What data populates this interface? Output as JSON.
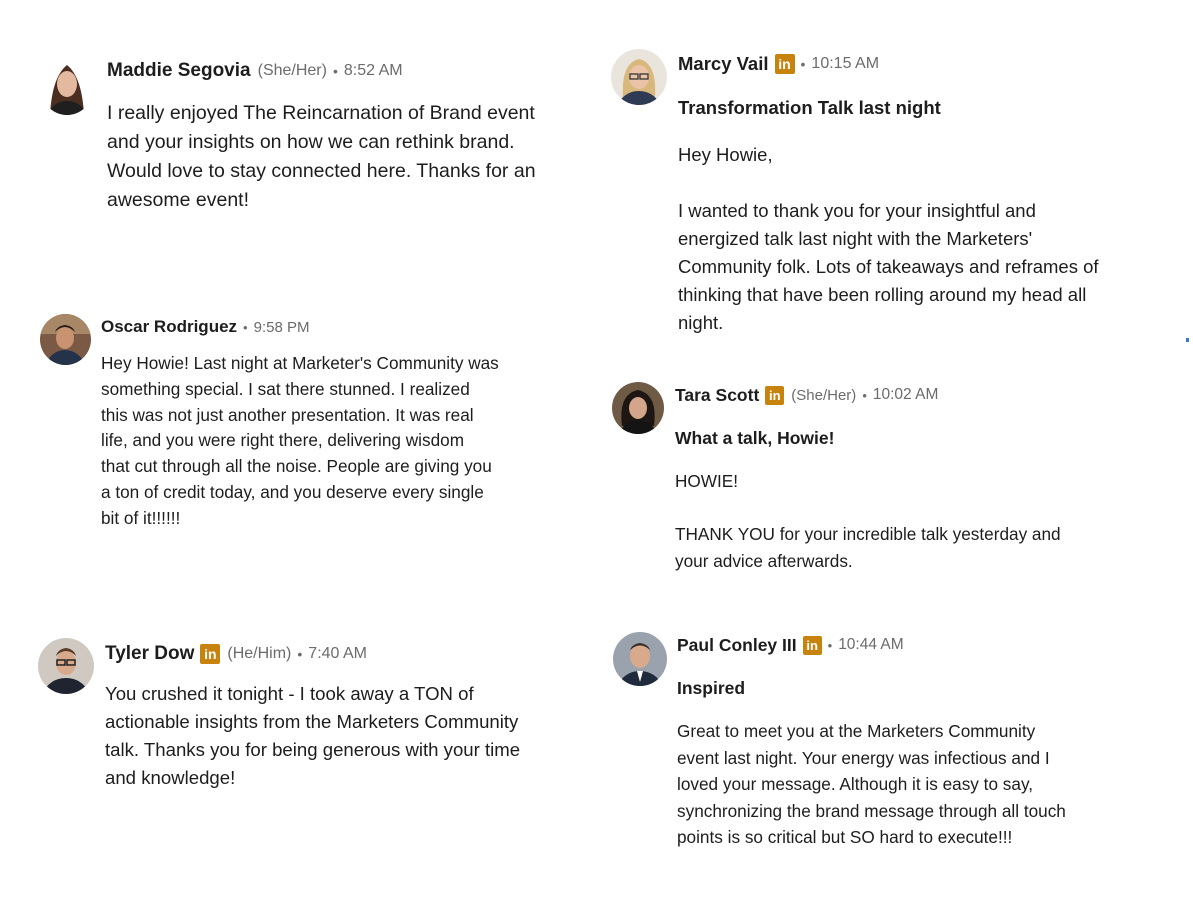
{
  "colors": {
    "linkedin_badge": "#c8830f",
    "meta_gray": "#6b6b6b",
    "text": "#1d1d1d"
  },
  "messages": [
    {
      "name": "Maddie Segovia",
      "pronouns": "(She/Her)",
      "time": "8:52 AM",
      "avatar": "person-avatar",
      "lines": [
        "I really enjoyed The Reincarnation of Brand event",
        "and your insights on how we can rethink brand.",
        "Would love to stay connected here. Thanks for an",
        "awesome event!"
      ]
    },
    {
      "name": "Oscar Rodriguez",
      "time": "9:58 PM",
      "avatar": "person-avatar",
      "lines": [
        "Hey Howie! Last night at Marketer's Community was",
        "something special. I sat there stunned. I realized",
        "this was not just another presentation. It was real",
        "life, and you were right there, delivering wisdom",
        "that cut through all the noise. People are giving you",
        "a ton of credit today, and you deserve every single",
        "bit of it!!!!!!"
      ]
    },
    {
      "name": "Tyler Dow",
      "badge": "in",
      "pronouns": "(He/Him)",
      "time": "7:40 AM",
      "avatar": "person-avatar",
      "lines": [
        "You crushed it tonight - I took away a TON of",
        "actionable insights from the Marketers Community",
        "talk. Thanks you for being generous with your time",
        "and knowledge!"
      ]
    },
    {
      "name": "Marcy Vail",
      "badge": "in",
      "time": "10:15 AM",
      "subject": "Transformation Talk last night",
      "avatar": "person-avatar",
      "greeting": "Hey Howie,",
      "lines": [
        "I wanted to thank you for your insightful and",
        "energized talk last night with the Marketers'",
        "Community folk. Lots of takeaways and reframes of",
        "thinking that have been rolling around my head all",
        "night."
      ]
    },
    {
      "name": "Tara Scott",
      "badge": "in",
      "pronouns": "(She/Her)",
      "time": "10:02 AM",
      "subject": "What a talk, Howie!",
      "avatar": "person-avatar",
      "greeting": "HOWIE!",
      "lines": [
        "THANK YOU for your incredible talk yesterday and",
        "your advice afterwards."
      ]
    },
    {
      "name": "Paul Conley III",
      "badge": "in",
      "time": "10:44 AM",
      "subject": "Inspired",
      "avatar": "person-avatar",
      "lines": [
        "Great to meet you at the Marketers Community",
        "event last night. Your energy was infectious and I",
        "loved your message. Although it is easy to say,",
        "synchronizing the brand message through all touch",
        "points is so critical but SO hard to execute!!!"
      ]
    }
  ]
}
